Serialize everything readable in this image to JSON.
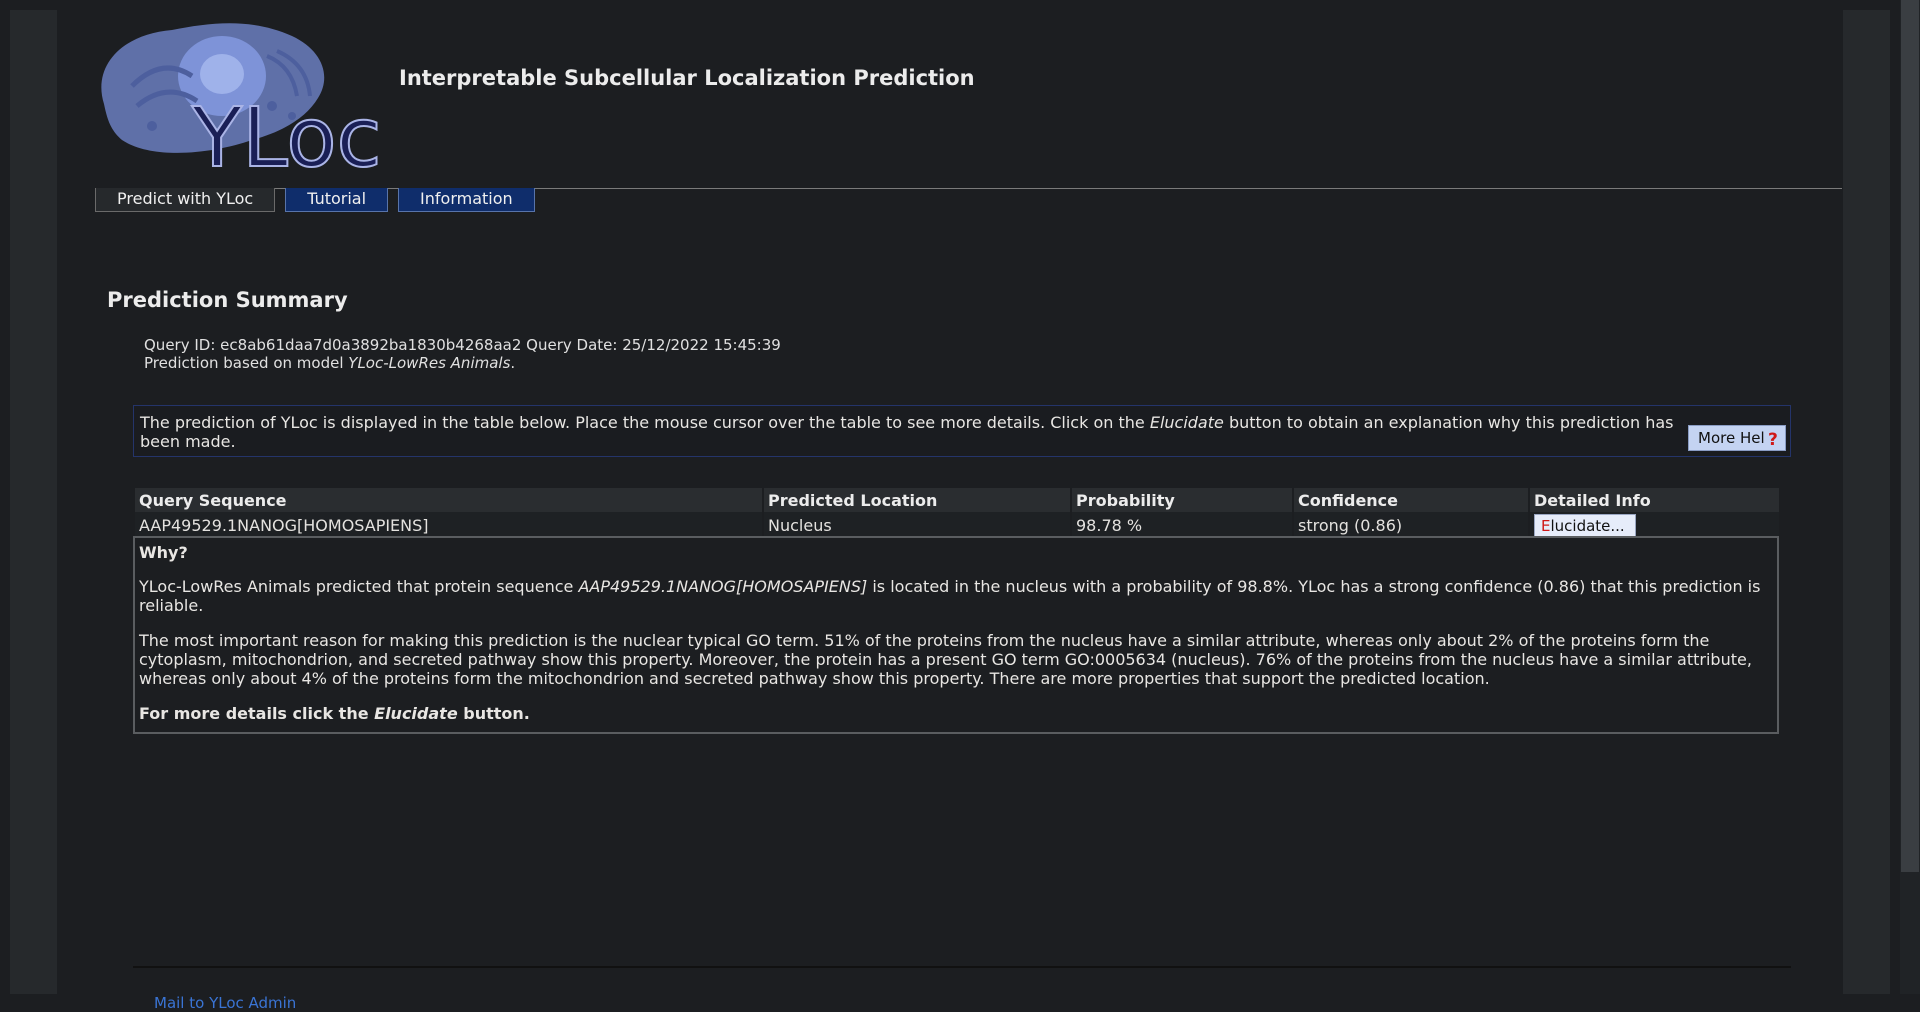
{
  "app": {
    "logo_text": "YLoc",
    "title": "Interpretable Subcellular Localization Prediction"
  },
  "tabs": [
    {
      "label": "Predict with YLoc",
      "active": true
    },
    {
      "label": "Tutorial",
      "active": false
    },
    {
      "label": "Information",
      "active": false
    }
  ],
  "summary": {
    "title": "Prediction Summary",
    "query_id_label": "Query ID:",
    "query_id": "ec8ab61daa7d0a3892ba1830b4268aa2",
    "query_date_label": "Query Date:",
    "query_date": "25/12/2022 15:45:39",
    "model_prefix": "Prediction based on model",
    "model_name": "YLoc-LowRes Animals",
    "model_suffix": "."
  },
  "help": {
    "text_before": "The prediction of YLoc is displayed in the table below. Place the mouse cursor over the table to see more details. Click on the",
    "text_em": "Elucidate",
    "text_after": "button to obtain an explanation why this prediction has been made.",
    "button_label": "More Hel",
    "button_icon": "?"
  },
  "table": {
    "headers": [
      "Query Sequence",
      "Predicted Location",
      "Probability",
      "Confidence",
      "Detailed Info"
    ],
    "row": {
      "sequence": "AAP49529.1NANOG[HOMOSAPIENS]",
      "location": "Nucleus",
      "probability": "98.78 %",
      "confidence": "strong (0.86)",
      "button_first": "E",
      "button_rest": "lucidate..."
    }
  },
  "why": {
    "title": "Why?",
    "p1_before": "YLoc-LowRes Animals predicted that protein sequence",
    "p1_em": "AAP49529.1NANOG[HOMOSAPIENS]",
    "p1_after": "is located in the nucleus with a probability of 98.8%. YLoc has a strong confidence (0.86) that this prediction is reliable.",
    "p2": "The most important reason for making this prediction is the nuclear typical GO term. 51% of the proteins from the nucleus have a similar attribute, whereas only about 2% of the proteins form the cytoplasm, mitochondrion, and secreted pathway show this property. Moreover, the protein has a present GO term GO:0005634 (nucleus). 76% of the proteins from the nucleus have a similar attribute, whereas only about 4% of the proteins form the mitochondrion and secreted pathway show this property. There are more properties that support the predicted location.",
    "foot_before": "For more details click the",
    "foot_em": "Elucidate",
    "foot_after": "button."
  },
  "footer": {
    "admin_link": "Mail to YLoc Admin"
  },
  "colors": {
    "background": "#1c1e21",
    "tab_other": "#0f2d6b",
    "button_accent": "#d01818",
    "link": "#3a74d4"
  }
}
